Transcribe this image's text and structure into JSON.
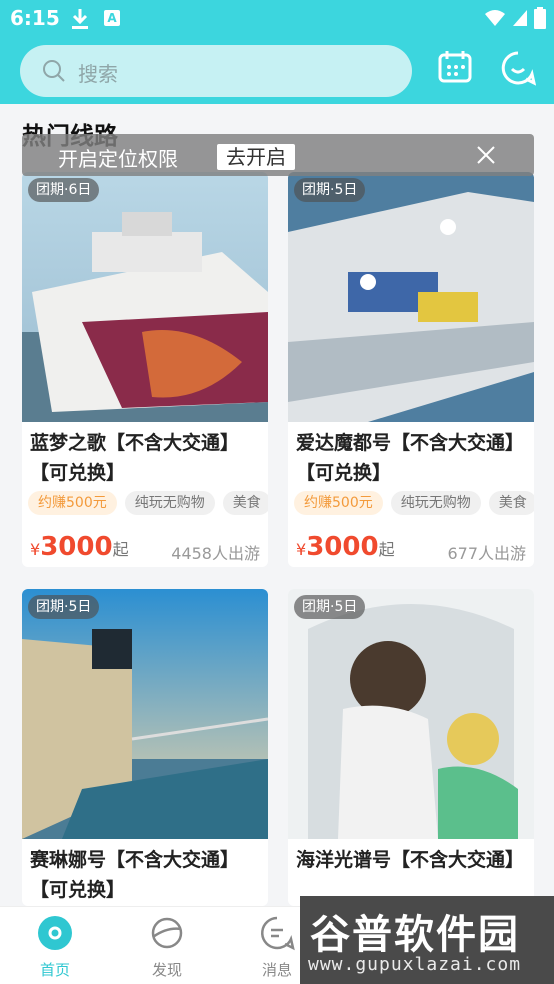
{
  "status_bar": {
    "time": "6:15"
  },
  "search": {
    "placeholder": "搜索"
  },
  "section": {
    "title": "热门线路"
  },
  "toast": {
    "message": "开启定位权限",
    "action": "去开启"
  },
  "cards": [
    {
      "badge": "团期·6日",
      "title": "蓝梦之歌【不含大交通】【可兑换】",
      "tags": [
        "约赚500元",
        "纯玩无购物",
        "美食"
      ],
      "price_symbol": "¥",
      "price": "3000",
      "price_suffix": "起",
      "sold": "4458人出游"
    },
    {
      "badge": "团期·5日",
      "title": "爱达魔都号【不含大交通】【可兑换】",
      "tags": [
        "约赚500元",
        "纯玩无购物",
        "美食"
      ],
      "price_symbol": "¥",
      "price": "3000",
      "price_suffix": "起",
      "sold": "677人出游"
    },
    {
      "badge": "团期·5日",
      "title": "赛琳娜号【不含大交通】【可兑换】"
    },
    {
      "badge": "团期·5日",
      "title": "海洋光谱号【不含大交通】"
    }
  ],
  "tabbar": {
    "items": [
      {
        "label": "首页"
      },
      {
        "label": "发现"
      },
      {
        "label": "消息"
      }
    ]
  },
  "watermark": {
    "title": "谷普软件园",
    "url": "www.gupuxlazai.com"
  },
  "colors": {
    "accent": "#3cd6de",
    "price": "#f04a2e",
    "tag_earn": "#f39a3b"
  }
}
